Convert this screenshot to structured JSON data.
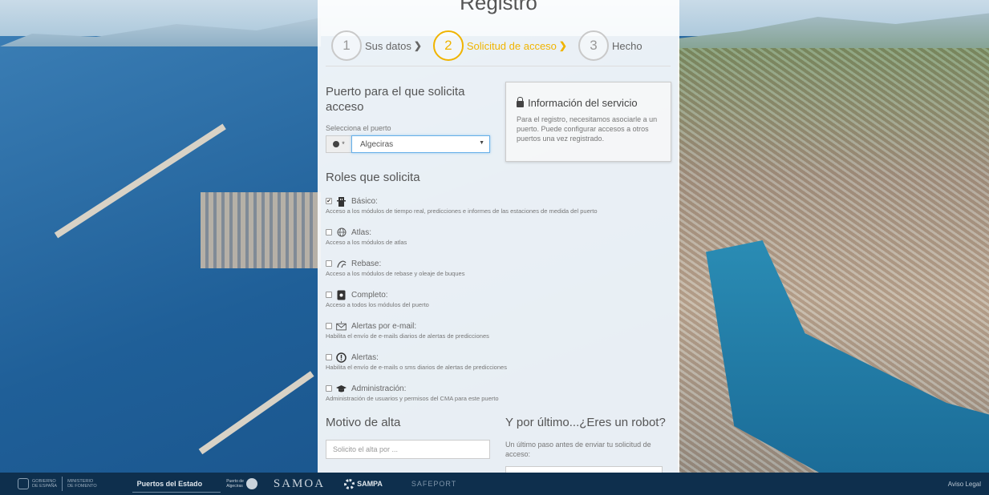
{
  "card": {
    "title": "Registro",
    "steps": [
      {
        "number": "1",
        "label": "Sus datos"
      },
      {
        "number": "2",
        "label": "Solicitud de acceso"
      },
      {
        "number": "3",
        "label": "Hecho"
      }
    ],
    "chevron": "❯"
  },
  "port": {
    "title": "Puerto para el que solicita acceso",
    "select_label": "Selecciona el puerto",
    "addon": "*",
    "selected": "Algeciras"
  },
  "info": {
    "title": "Información del servicio",
    "text": "Para el registro, necesitamos asociarle a un puerto. Puede configurar accesos a otros puertos una vez registrado."
  },
  "roles": {
    "title": "Roles que solicita",
    "items": [
      {
        "name": "Básico:",
        "desc": "Acceso a los módulos de tiempo real, predicciones e informes de las estaciones de medida del puerto",
        "checked": true,
        "icon": "tower-icon"
      },
      {
        "name": "Atlas:",
        "desc": "Acceso a los módulos de atlas",
        "checked": false,
        "icon": "globe-icon"
      },
      {
        "name": "Rebase:",
        "desc": "Acceso a los módulos de rebase y oleaje de buques",
        "checked": false,
        "icon": "wave-icon"
      },
      {
        "name": "Completo:",
        "desc": "Acceso a todos los módulos del puerto",
        "checked": false,
        "icon": "device-icon"
      },
      {
        "name": "Alertas por e-mail:",
        "desc": "Habilita el envío de e-mails diarios de alertas de predicciones",
        "checked": false,
        "icon": "mail-alert-icon"
      },
      {
        "name": "Alertas:",
        "desc": "Habilita el envío de e-mails o sms diarios de alertas de predicciones",
        "checked": false,
        "icon": "alert-icon"
      },
      {
        "name": "Administración:",
        "desc": "Administración de usuarios y permisos del CMA para este puerto",
        "checked": false,
        "icon": "admin-icon"
      }
    ]
  },
  "motivo": {
    "title": "Motivo de alta",
    "placeholder": "Solicito el alta por ..."
  },
  "robot": {
    "title": "Y por último...¿Eres un robot?",
    "text": "Un último paso antes de enviar tu solicitud de acceso:"
  },
  "footer": {
    "gobierno_1": "Gobierno",
    "gobierno_2": "de España",
    "ministerio_1": "Ministerio",
    "ministerio_2": "de Fomento",
    "puertos_estado": "Puertos del Estado",
    "pda_1": "Puerto de",
    "pda_2": "Algeciras",
    "samoa": "SAMOA",
    "sampa": "SAMPA",
    "safeport": "SAFEPORT",
    "aviso": "Aviso Legal"
  },
  "colors": {
    "accent": "#f0b400",
    "footer_bg": "#0e2f4d",
    "select_focus": "#66afe9"
  }
}
